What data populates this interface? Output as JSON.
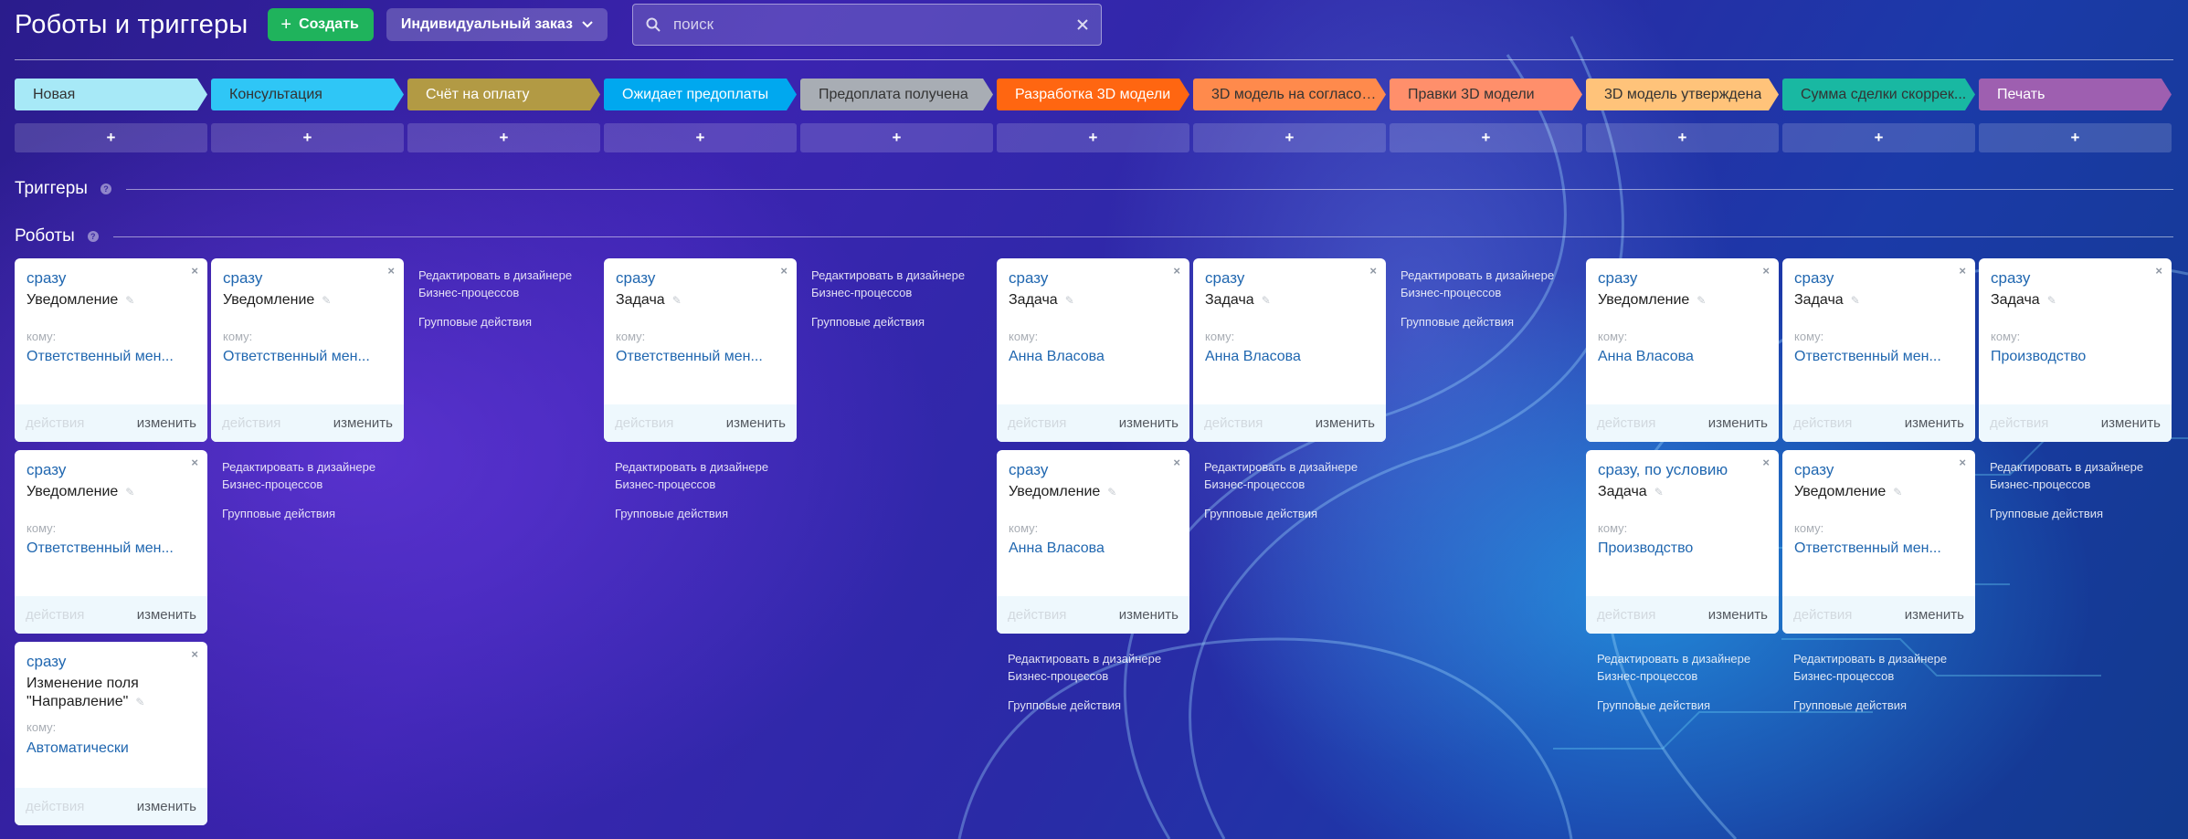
{
  "header": {
    "title": "Роботы и триггеры",
    "create_label": "Создать",
    "order_label": "Индивидуальный заказ",
    "search_placeholder": "поиск"
  },
  "stages": [
    {
      "label": "Новая",
      "color": "#a7e9f7",
      "text": "#333333"
    },
    {
      "label": "Консультация",
      "color": "#2fc6f6",
      "text": "#333333"
    },
    {
      "label": "Счёт на оплату",
      "color": "#b29a44",
      "text": "#ffffff"
    },
    {
      "label": "Ожидает предоплаты",
      "color": "#00a8ef",
      "text": "#ffffff"
    },
    {
      "label": "Предоплата получена",
      "color": "#a8adb4",
      "text": "#333333"
    },
    {
      "label": "Разработка 3D модели",
      "color": "#ff6611",
      "text": "#ffffff"
    },
    {
      "label": "3D модель на согласов...",
      "color": "#ff8a4c",
      "text": "#333333"
    },
    {
      "label": "Правки 3D модели",
      "color": "#ff8f6b",
      "text": "#333333"
    },
    {
      "label": "3D модель утверждена",
      "color": "#ffc37a",
      "text": "#333333"
    },
    {
      "label": "Сумма сделки скоррек...",
      "color": "#19b8a2",
      "text": "#333333"
    },
    {
      "label": "Печать",
      "color": "#9e5fb0",
      "text": "#ffffff"
    }
  ],
  "stage_add_label": "+",
  "sections": {
    "triggers": "Триггеры",
    "robots": "Роботы",
    "help": "?"
  },
  "card_common": {
    "to_label": "кому:",
    "actions_label": "действия",
    "edit_label": "изменить",
    "close": "×",
    "pencil": "✎"
  },
  "links": {
    "designer_line1": "Редактировать в дизайнере",
    "designer_line2": "Бизнес-процессов",
    "group": "Групповые действия"
  },
  "robots": [
    {
      "col": 0,
      "row": 0,
      "delay": "сразу",
      "name": "Уведомление",
      "to": "Ответственный мен..."
    },
    {
      "col": 0,
      "row": 1,
      "delay": "сразу",
      "name": "Уведомление",
      "to": "Ответственный мен..."
    },
    {
      "col": 0,
      "row": 2,
      "delay": "сразу",
      "name": "Изменение поля \"Направление\"",
      "to": "Автоматически"
    },
    {
      "col": 1,
      "row": 0,
      "delay": "сразу",
      "name": "Уведомление",
      "to": "Ответственный мен..."
    },
    {
      "col": 3,
      "row": 0,
      "delay": "сразу",
      "name": "Задача",
      "to": "Ответственный мен..."
    },
    {
      "col": 5,
      "row": 0,
      "delay": "сразу",
      "name": "Задача",
      "to": "Анна Власова"
    },
    {
      "col": 5,
      "row": 1,
      "delay": "сразу",
      "name": "Уведомление",
      "to": "Анна Власова"
    },
    {
      "col": 6,
      "row": 0,
      "delay": "сразу",
      "name": "Задача",
      "to": "Анна Власова"
    },
    {
      "col": 8,
      "row": 0,
      "delay": "сразу",
      "name": "Уведомление",
      "to": "Анна Власова"
    },
    {
      "col": 8,
      "row": 1,
      "delay": "сразу, по условию",
      "name": "Задача",
      "to": "Производство"
    },
    {
      "col": 9,
      "row": 0,
      "delay": "сразу",
      "name": "Задача",
      "to": "Ответственный мен..."
    },
    {
      "col": 9,
      "row": 1,
      "delay": "сразу",
      "name": "Уведомление",
      "to": "Ответственный мен..."
    },
    {
      "col": 10,
      "row": 0,
      "delay": "сразу",
      "name": "Задача",
      "to": "Производство"
    }
  ],
  "link_blocks": [
    {
      "col": 2,
      "row": 0
    },
    {
      "col": 4,
      "row": 0
    },
    {
      "col": 7,
      "row": 0
    },
    {
      "col": 1,
      "row": 1
    },
    {
      "col": 3,
      "row": 1
    },
    {
      "col": 6,
      "row": 1
    },
    {
      "col": 10,
      "row": 1
    },
    {
      "col": 5,
      "row": 2
    },
    {
      "col": 8,
      "row": 2
    },
    {
      "col": 9,
      "row": 2
    }
  ]
}
